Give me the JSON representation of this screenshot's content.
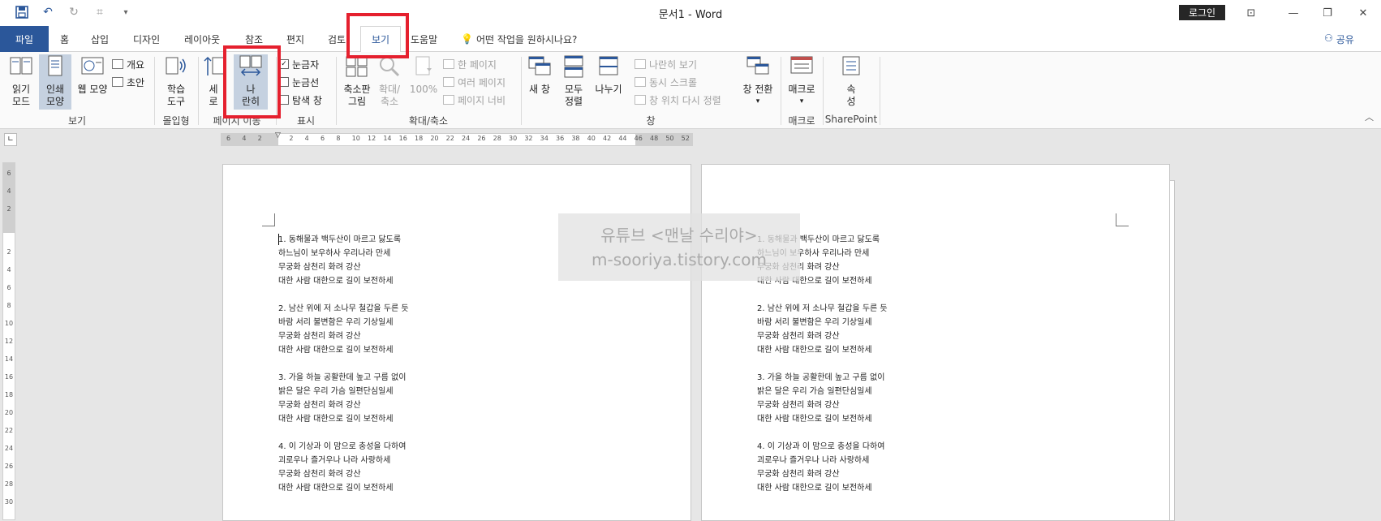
{
  "window": {
    "title": "문서1  -  Word",
    "login_label": "로그인"
  },
  "quick_access": {
    "icons": [
      "save-icon",
      "undo-icon",
      "redo-icon",
      "customize-icon"
    ]
  },
  "tabs": [
    {
      "label": "파일"
    },
    {
      "label": "홈"
    },
    {
      "label": "삽입"
    },
    {
      "label": "디자인"
    },
    {
      "label": "레이아웃"
    },
    {
      "label": "참조"
    },
    {
      "label": "편지"
    },
    {
      "label": "검토"
    },
    {
      "label": "보기",
      "active": true
    },
    {
      "label": "도움말"
    }
  ],
  "tell_me": "어떤 작업을 원하시나요?",
  "share_label": "공유",
  "ribbon": {
    "groups": {
      "views": "보기",
      "immersive": "몰입형",
      "page_movement": "페이지 이동",
      "show": "표시",
      "zoom": "확대/축소",
      "window": "창",
      "macros": "매크로",
      "sharepoint": "SharePoint"
    },
    "views": {
      "read_mode": [
        "읽기",
        "모드"
      ],
      "print_layout": [
        "인쇄",
        "모양"
      ],
      "web_layout": "웹 모양",
      "outline": "개요",
      "draft": "초안"
    },
    "immersive": {
      "learning_tools": [
        "학습",
        "도구"
      ]
    },
    "page_movement": {
      "vertical": [
        "세",
        "로"
      ],
      "side_by_side": [
        "나",
        "란히"
      ]
    },
    "show": {
      "ruler": "눈금자",
      "gridlines": "눈금선",
      "navigation_pane": "탐색 창"
    },
    "zoom": {
      "zoom": [
        "축소판",
        "그림"
      ],
      "zoom_in_out": [
        "확대/",
        "축소"
      ],
      "hundred": "100%",
      "one_page": "한 페이지",
      "multiple_pages": "여러 페이지",
      "page_width": "페이지 너비"
    },
    "window": {
      "new_window": "새 창",
      "arrange_all": [
        "모두",
        "정렬"
      ],
      "split": "나누기",
      "view_side_by_side": "나란히 보기",
      "sync_scroll": "동시 스크롤",
      "reset_position": "창 위치 다시 정렬",
      "switch_windows": "창 전환"
    },
    "macros": {
      "macros": "매크로"
    },
    "sharepoint": {
      "properties": [
        "속",
        "성"
      ]
    }
  },
  "ruler": {
    "h_ticks": [
      "6",
      "4",
      "2",
      "2",
      "4",
      "6",
      "8",
      "10",
      "12",
      "14",
      "16",
      "18",
      "20",
      "22",
      "24",
      "26",
      "28",
      "30",
      "32",
      "34",
      "36",
      "38",
      "40",
      "42",
      "44",
      "46",
      "48",
      "50",
      "52"
    ],
    "v_ticks": [
      "6",
      "4",
      "2",
      "2",
      "4",
      "6",
      "8",
      "10",
      "12",
      "14",
      "16",
      "18",
      "20",
      "22",
      "24",
      "26",
      "28",
      "30"
    ]
  },
  "document": {
    "stanzas": [
      [
        "1. 동해물과 백두산이 마르고 닳도록",
        "하느님이 보우하사 우리나라 만세",
        "무궁화 삼천리 화려 강산",
        "대한 사람 대한으로 길이 보전하세"
      ],
      [
        "2. 남산 위에 저 소나무 철갑을 두른 듯",
        "바람 서리 불변함은 우리 기상일세",
        "무궁화 삼천리 화려 강산",
        "대한 사람 대한으로 길이 보전하세"
      ],
      [
        "3. 가을 하늘 공활한데 높고 구름 없이",
        "밝은 달은 우리 가슴 일편단심일세",
        "무궁화 삼천리 화려 강산",
        "대한 사람 대한으로 길이 보전하세"
      ],
      [
        "4. 이 기상과 이 맘으로 충성을 다하여",
        "괴로우나 즐거우나 나라 사랑하세",
        "무궁화 삼천리 화려 강산",
        "대한 사람 대한으로 길이 보전하세"
      ]
    ]
  },
  "watermark": {
    "line1": "유튜브 <맨날 수리야>",
    "line2": "m-sooriya.tistory.com"
  },
  "colors": {
    "brand": "#2b579a",
    "highlight": "#e5202e",
    "selected": "#c5d1e0"
  }
}
